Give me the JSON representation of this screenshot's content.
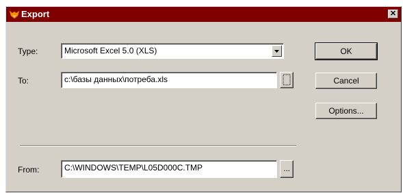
{
  "window": {
    "title": "Export",
    "close_label": "✕"
  },
  "type_row": {
    "label": "Type:",
    "value": "Microsoft Excel 5.0 (XLS)"
  },
  "to_row": {
    "label": "To:",
    "value": "c:\\базы данных\\потреба.xls"
  },
  "from_row": {
    "label": "From:",
    "value": "C:\\WINDOWS\\TEMP\\L05D000C.TMP",
    "browse_label": "..."
  },
  "buttons": {
    "ok": "OK",
    "cancel": "Cancel",
    "options": "Options..."
  },
  "colors": {
    "titlebar": "#7f0000",
    "face": "#d4d0c8"
  }
}
